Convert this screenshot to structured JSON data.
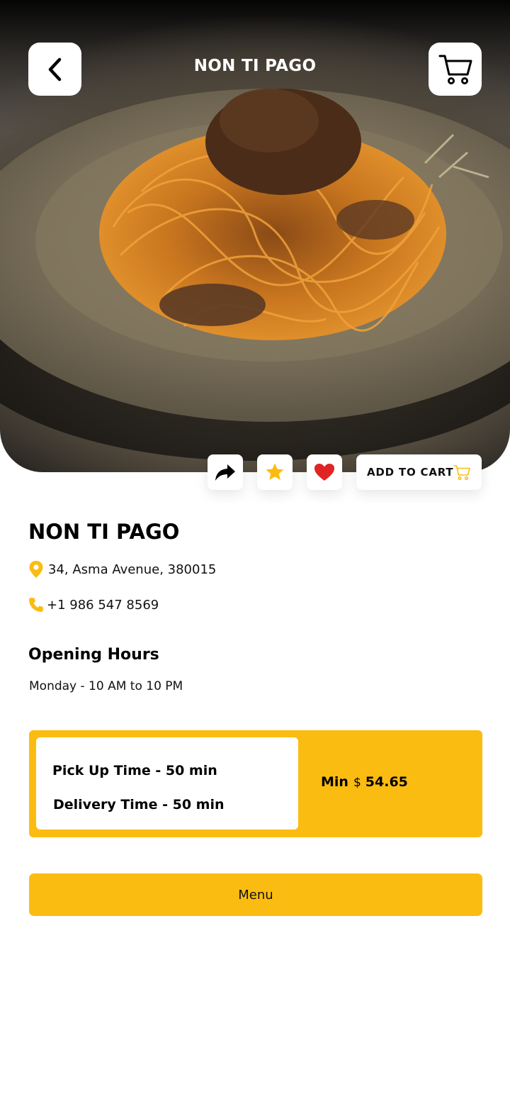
{
  "header": {
    "title": "NON TI PAGO",
    "back_icon": "chevron-left-icon",
    "cart_icon": "shopping-cart-icon"
  },
  "actions": {
    "share_icon": "share-arrow-icon",
    "star_icon": "star-icon",
    "heart_icon": "heart-icon",
    "add_to_cart_label": "ADD TO CART",
    "add_to_cart_icon": "shopping-cart-icon"
  },
  "restaurant": {
    "name": "NON TI PAGO",
    "address": "34, Asma Avenue, 380015",
    "phone": "+1 986 547 8569"
  },
  "hours": {
    "title": "Opening Hours",
    "text": "Monday - 10 AM to 10 PM"
  },
  "times": {
    "pickup": "Pick Up Time - 50 min",
    "delivery": "Delivery Time - 50 min",
    "min_label": "Min",
    "currency": "$",
    "min_amount": "54.65"
  },
  "menu_button": "Menu",
  "colors": {
    "accent": "#fbbc12",
    "heart": "#e02424",
    "star": "#fbbc12"
  }
}
